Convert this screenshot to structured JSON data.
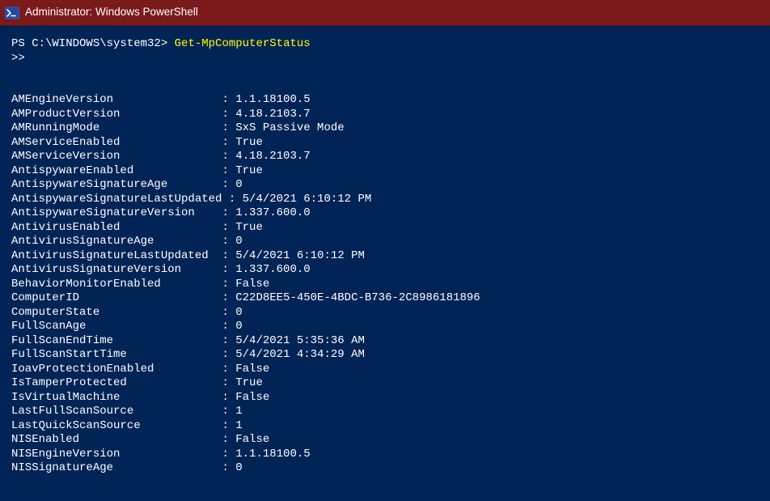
{
  "window": {
    "title": "Administrator: Windows PowerShell"
  },
  "prompt": {
    "prefix": "PS C:\\WINDOWS\\system32> ",
    "command": "Get-MpComputerStatus",
    "continuation": ">>"
  },
  "output": {
    "rows": [
      {
        "key": "AMEngineVersion",
        "value": "1.1.18100.5"
      },
      {
        "key": "AMProductVersion",
        "value": "4.18.2103.7"
      },
      {
        "key": "AMRunningMode",
        "value": "SxS Passive Mode"
      },
      {
        "key": "AMServiceEnabled",
        "value": "True"
      },
      {
        "key": "AMServiceVersion",
        "value": "4.18.2103.7"
      },
      {
        "key": "AntispywareEnabled",
        "value": "True"
      },
      {
        "key": "AntispywareSignatureAge",
        "value": "0"
      },
      {
        "key": "AntispywareSignatureLastUpdated",
        "value": "5/4/2021 6:10:12 PM"
      },
      {
        "key": "AntispywareSignatureVersion",
        "value": "1.337.600.0"
      },
      {
        "key": "AntivirusEnabled",
        "value": "True"
      },
      {
        "key": "AntivirusSignatureAge",
        "value": "0"
      },
      {
        "key": "AntivirusSignatureLastUpdated",
        "value": "5/4/2021 6:10:12 PM"
      },
      {
        "key": "AntivirusSignatureVersion",
        "value": "1.337.600.0"
      },
      {
        "key": "BehaviorMonitorEnabled",
        "value": "False"
      },
      {
        "key": "ComputerID",
        "value": "C22D8EE5-450E-4BDC-B736-2C8986181896"
      },
      {
        "key": "ComputerState",
        "value": "0"
      },
      {
        "key": "FullScanAge",
        "value": "0"
      },
      {
        "key": "FullScanEndTime",
        "value": "5/4/2021 5:35:36 AM"
      },
      {
        "key": "FullScanStartTime",
        "value": "5/4/2021 4:34:29 AM"
      },
      {
        "key": "IoavProtectionEnabled",
        "value": "False"
      },
      {
        "key": "IsTamperProtected",
        "value": "True"
      },
      {
        "key": "IsVirtualMachine",
        "value": "False"
      },
      {
        "key": "LastFullScanSource",
        "value": "1"
      },
      {
        "key": "LastQuickScanSource",
        "value": "1"
      },
      {
        "key": "NISEnabled",
        "value": "False"
      },
      {
        "key": "NISEngineVersion",
        "value": "1.1.18100.5"
      },
      {
        "key": "NISSignatureAge",
        "value": "0"
      }
    ],
    "keyWidth": 31
  }
}
